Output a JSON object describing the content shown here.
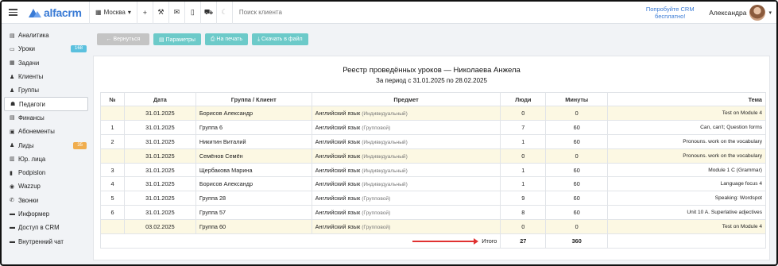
{
  "app": {
    "logo_text": "alfacrm",
    "city": "Москва",
    "search_placeholder": "Поиск клиента",
    "promo": "Попробуйте CRM бесплатно!",
    "user_name": "Александра"
  },
  "sidebar": {
    "items": [
      {
        "icon": "▤",
        "label": "Аналитика"
      },
      {
        "icon": "▭",
        "label": "Уроки",
        "badge": "168"
      },
      {
        "icon": "▦",
        "label": "Задачи"
      },
      {
        "icon": "♟",
        "label": "Клиенты"
      },
      {
        "icon": "♟",
        "label": "Группы"
      },
      {
        "icon": "☗",
        "label": "Педагоги"
      },
      {
        "icon": "▤",
        "label": "Финансы"
      },
      {
        "icon": "▣",
        "label": "Абонементы"
      },
      {
        "icon": "♟",
        "label": "Лиды",
        "badge": "35"
      },
      {
        "icon": "▥",
        "label": "Юр. лица"
      },
      {
        "icon": "▮",
        "label": "Podpislon"
      },
      {
        "icon": "◉",
        "label": "Wazzup"
      },
      {
        "icon": "✆",
        "label": "Звонки"
      },
      {
        "icon": "▬",
        "label": "Информер"
      },
      {
        "icon": "▬",
        "label": "Доступ в CRM"
      },
      {
        "icon": "▬",
        "label": "Внутренний чат"
      }
    ]
  },
  "toolbar": {
    "back": "← Вернуться",
    "params": "▤ Параметры",
    "print": "⎙ На печать",
    "download": "⤓ Скачать в файл"
  },
  "report": {
    "title": "Реестр проведённых уроков — Николаева Анжела",
    "period": "За период с 31.01.2025 по 28.02.2025",
    "columns": [
      "№",
      "Дата",
      "Группа / Клиент",
      "Предмет",
      "Люди",
      "Минуты",
      "Тема"
    ],
    "rows": [
      {
        "n": "",
        "date": "31.01.2025",
        "client": "Борисов Александр",
        "subject": "Английский язык",
        "type": "(Индивидуальный)",
        "people": "0",
        "minutes": "0",
        "topic": "Test on Module 4"
      },
      {
        "n": "1",
        "date": "31.01.2025",
        "client": "Группа 6",
        "subject": "Английский язык",
        "type": "(Групповой)",
        "people": "7",
        "minutes": "60",
        "topic": "Can, can't; Question forms"
      },
      {
        "n": "2",
        "date": "31.01.2025",
        "client": "Никитин Виталий",
        "subject": "Английский язык",
        "type": "(Индивидуальный)",
        "people": "1",
        "minutes": "60",
        "topic": "Pronouns. work on the vocabulary"
      },
      {
        "n": "",
        "date": "31.01.2025",
        "client": "Семёнов Семён",
        "subject": "Английский язык",
        "type": "(Индивидуальный)",
        "people": "0",
        "minutes": "0",
        "topic": "Pronouns. work on the vocabulary"
      },
      {
        "n": "3",
        "date": "31.01.2025",
        "client": "Щербакова Марина",
        "subject": "Английский язык",
        "type": "(Индивидуальный)",
        "people": "1",
        "minutes": "60",
        "topic": "Module 1 C (Grammar)"
      },
      {
        "n": "4",
        "date": "31.01.2025",
        "client": "Борисов Александр",
        "subject": "Английский язык",
        "type": "(Индивидуальный)",
        "people": "1",
        "minutes": "60",
        "topic": "Language focus 4"
      },
      {
        "n": "5",
        "date": "31.01.2025",
        "client": "Группа 28",
        "subject": "Английский язык",
        "type": "(Групповой)",
        "people": "9",
        "minutes": "60",
        "topic": "Speaking: Wordspot"
      },
      {
        "n": "6",
        "date": "31.01.2025",
        "client": "Группа 57",
        "subject": "Английский язык",
        "type": "(Групповой)",
        "people": "8",
        "minutes": "60",
        "topic": "Unit 10 A. Superlative adjectives"
      },
      {
        "n": "",
        "date": "03.02.2025",
        "client": "Группа 60",
        "subject": "Английский язык",
        "type": "(Групповой)",
        "people": "0",
        "minutes": "0",
        "topic": "Test on Module 4"
      }
    ],
    "highlight_color": "#fcf8e3",
    "totals": {
      "label": "Итого",
      "people": "27",
      "minutes": "360"
    }
  },
  "colors": {
    "accent": "#3a7bd5",
    "teal_button": "#6ccac9",
    "arrow": "#e03131"
  }
}
